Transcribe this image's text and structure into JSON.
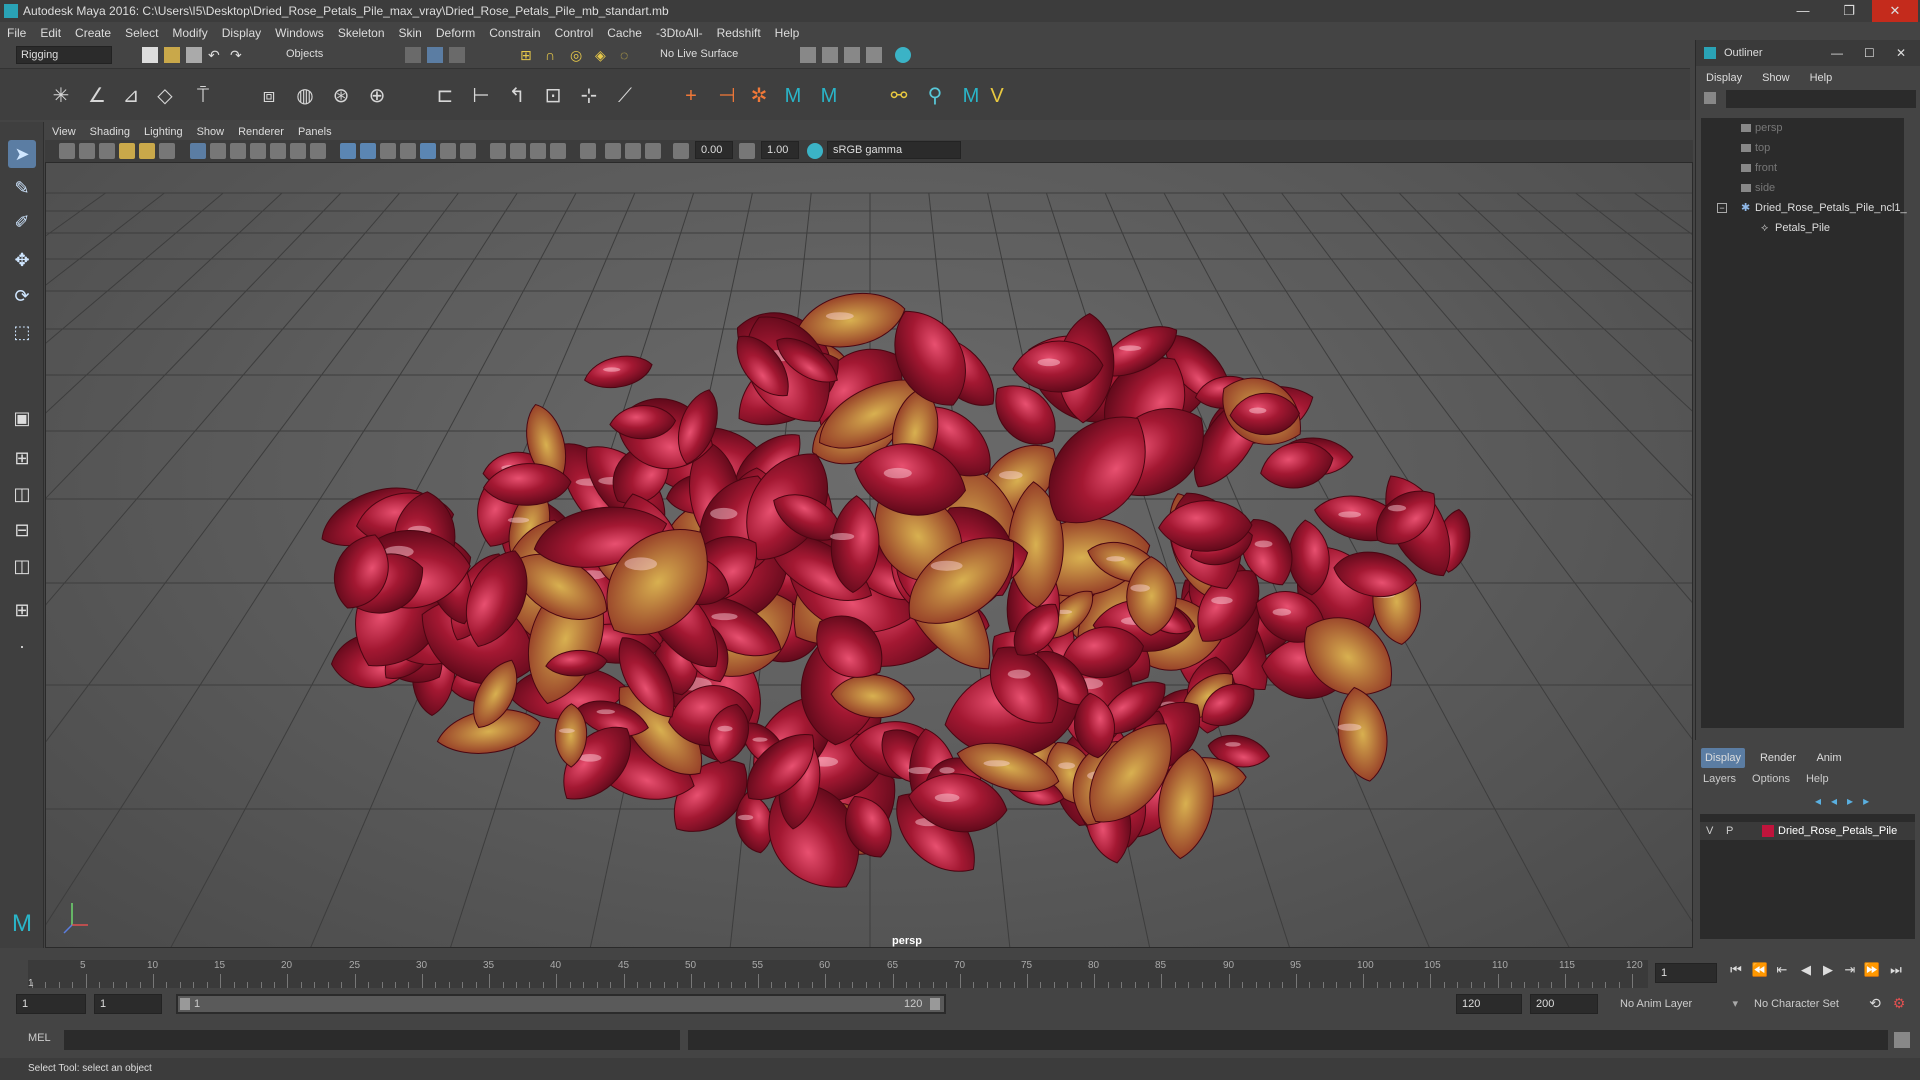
{
  "window": {
    "title": "Autodesk Maya 2016: C:\\Users\\I5\\Desktop\\Dried_Rose_Petals_Pile_max_vray\\Dried_Rose_Petals_Pile_mb_standart.mb",
    "controls": [
      "—",
      "❐",
      "✕"
    ]
  },
  "menubar": [
    "File",
    "Edit",
    "Create",
    "Select",
    "Modify",
    "Display",
    "Windows",
    "Skeleton",
    "Skin",
    "Deform",
    "Constrain",
    "Control",
    "Cache",
    "-3DtoAll-",
    "Redshift",
    "Help"
  ],
  "statusline": {
    "menuset": "Rigging",
    "selection_mask": "Objects",
    "live_surface": "No Live Surface"
  },
  "viewport": {
    "menus": [
      "View",
      "Shading",
      "Lighting",
      "Show",
      "Renderer",
      "Panels"
    ],
    "exposure": "0.00",
    "gamma": "1.00",
    "colorspace": "sRGB gamma",
    "camera_label": "persp"
  },
  "outliner": {
    "title": "Outliner",
    "menus": [
      "Display",
      "Show",
      "Help"
    ],
    "items": [
      {
        "label": "persp",
        "dim": true
      },
      {
        "label": "top",
        "dim": true
      },
      {
        "label": "front",
        "dim": true
      },
      {
        "label": "side",
        "dim": true
      },
      {
        "label": "Dried_Rose_Petals_Pile_ncl1_",
        "dim": false
      },
      {
        "label": "Petals_Pile",
        "dim": false
      }
    ]
  },
  "layer_editor": {
    "tabs": [
      "Display",
      "Render",
      "Anim"
    ],
    "menus": [
      "Layers",
      "Options",
      "Help"
    ],
    "layer": {
      "v": "V",
      "p": "P",
      "name": "Dried_Rose_Petals_Pile",
      "color": "#c0143c"
    }
  },
  "timeline": {
    "ticks": [
      "5",
      "10",
      "15",
      "20",
      "25",
      "30",
      "35",
      "40",
      "45",
      "50",
      "55",
      "60",
      "65",
      "70",
      "75",
      "80",
      "85",
      "90",
      "95",
      "100",
      "105",
      "110",
      "115",
      "120"
    ],
    "start_marker": "1",
    "current_frame": "1"
  },
  "range": {
    "start": "1",
    "playback_start": "1",
    "range_start": "1",
    "range_end": "120",
    "playback_end": "120",
    "end": "200",
    "anim_layer": "No Anim Layer",
    "character_set": "No Character Set"
  },
  "cmdline": {
    "label": "MEL"
  },
  "helpline": "Select Tool: select an object",
  "colors": {
    "accent": "#2aa3b6",
    "petal": "#a01830",
    "ui_bg": "#444444"
  }
}
